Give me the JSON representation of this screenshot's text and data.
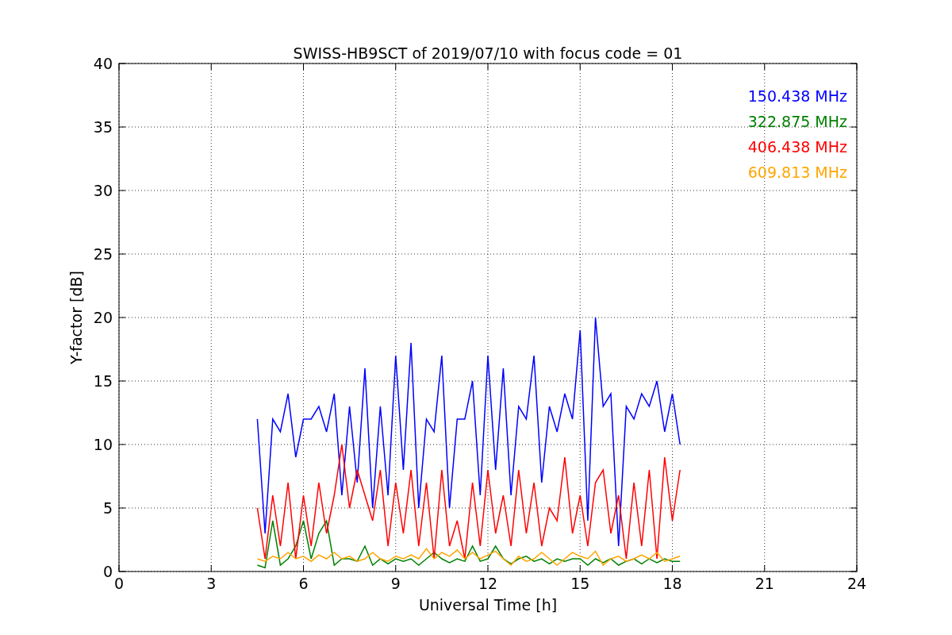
{
  "figure": {
    "chart_data": {
      "type": "line",
      "grid": true,
      "title": "SWISS-HB9SCT of 2019/07/10 with focus code = 01",
      "xlabel": "Universal Time [h]",
      "ylabel": "Y-factor [dB]",
      "xlim": [
        0,
        24
      ],
      "ylim": [
        0,
        40
      ],
      "xticks": [
        0,
        3,
        6,
        9,
        12,
        15,
        18,
        21,
        24
      ],
      "yticks": [
        0,
        5,
        10,
        15,
        20,
        25,
        30,
        35,
        40
      ],
      "x": [
        4.5,
        4.75,
        5,
        5.25,
        5.5,
        5.75,
        6,
        6.25,
        6.5,
        6.75,
        7,
        7.25,
        7.5,
        7.75,
        8,
        8.25,
        8.5,
        8.75,
        9,
        9.25,
        9.5,
        9.75,
        10,
        10.25,
        10.5,
        10.75,
        11,
        11.25,
        11.5,
        11.75,
        12,
        12.25,
        12.5,
        12.75,
        13,
        13.25,
        13.5,
        13.75,
        14,
        14.25,
        14.5,
        14.75,
        15,
        15.25,
        15.5,
        15.75,
        16,
        16.25,
        16.5,
        16.75,
        17,
        17.25,
        17.5,
        17.75,
        18,
        18.25
      ],
      "series": [
        {
          "name": "150.438 MHz",
          "color": "#0000ff",
          "values": [
            12,
            3,
            12,
            11,
            14,
            9,
            12,
            12,
            13,
            11,
            14,
            6,
            13,
            7,
            16,
            5,
            13,
            6,
            17,
            8,
            18,
            5,
            12,
            11,
            17,
            5,
            12,
            12,
            15,
            6,
            17,
            8,
            16,
            6,
            13,
            12,
            17,
            7,
            13,
            11,
            14,
            12,
            19,
            4,
            20,
            13,
            14,
            2,
            13,
            12,
            14,
            13,
            15,
            11,
            14,
            10
          ]
        },
        {
          "name": "322.875 MHz",
          "color": "#008000",
          "values": [
            0.5,
            0.3,
            4,
            0.5,
            1,
            2,
            4,
            1,
            3,
            4,
            0.5,
            1,
            1,
            0.8,
            2,
            0.5,
            1,
            0.6,
            1,
            0.8,
            1,
            0.5,
            1,
            1.5,
            1,
            0.7,
            1,
            0.8,
            2,
            0.8,
            1,
            2,
            1,
            0.6,
            1,
            1.2,
            0.8,
            1,
            0.6,
            1,
            0.8,
            1,
            1,
            0.5,
            1,
            0.7,
            1,
            0.5,
            0.8,
            1,
            0.6,
            1,
            0.7,
            1,
            0.8,
            0.8
          ]
        },
        {
          "name": "406.438 MHz",
          "color": "#ff0000",
          "values": [
            5,
            1,
            6,
            2,
            7,
            1,
            6,
            2,
            7,
            3,
            6,
            10,
            5,
            8,
            6,
            4,
            8,
            2,
            7,
            3,
            8,
            2,
            7,
            1,
            8,
            2,
            4,
            1,
            7,
            2,
            8,
            3,
            6,
            2,
            8,
            3,
            7,
            2,
            5,
            4,
            9,
            3,
            6,
            2,
            7,
            8,
            3,
            6,
            1,
            7,
            2,
            8,
            1,
            9,
            4,
            8
          ]
        },
        {
          "name": "609.813 MHz",
          "color": "#ffa500",
          "values": [
            1,
            0.8,
            1.2,
            1,
            1.5,
            1,
            1.2,
            0.8,
            1.3,
            1,
            1.5,
            1,
            1.2,
            0.8,
            1,
            1.5,
            1,
            0.8,
            1.2,
            1,
            1.3,
            1,
            1.8,
            1,
            1.5,
            1.2,
            1.7,
            1,
            1.5,
            1,
            1.3,
            1.6,
            1,
            0.5,
            1.2,
            0.8,
            1,
            1.5,
            1,
            0.5,
            1,
            1.5,
            1.2,
            1,
            1.6,
            0.5,
            1,
            1.2,
            0.8,
            1,
            1.3,
            1,
            1.5,
            0.8,
            1,
            1.2
          ]
        }
      ]
    }
  }
}
